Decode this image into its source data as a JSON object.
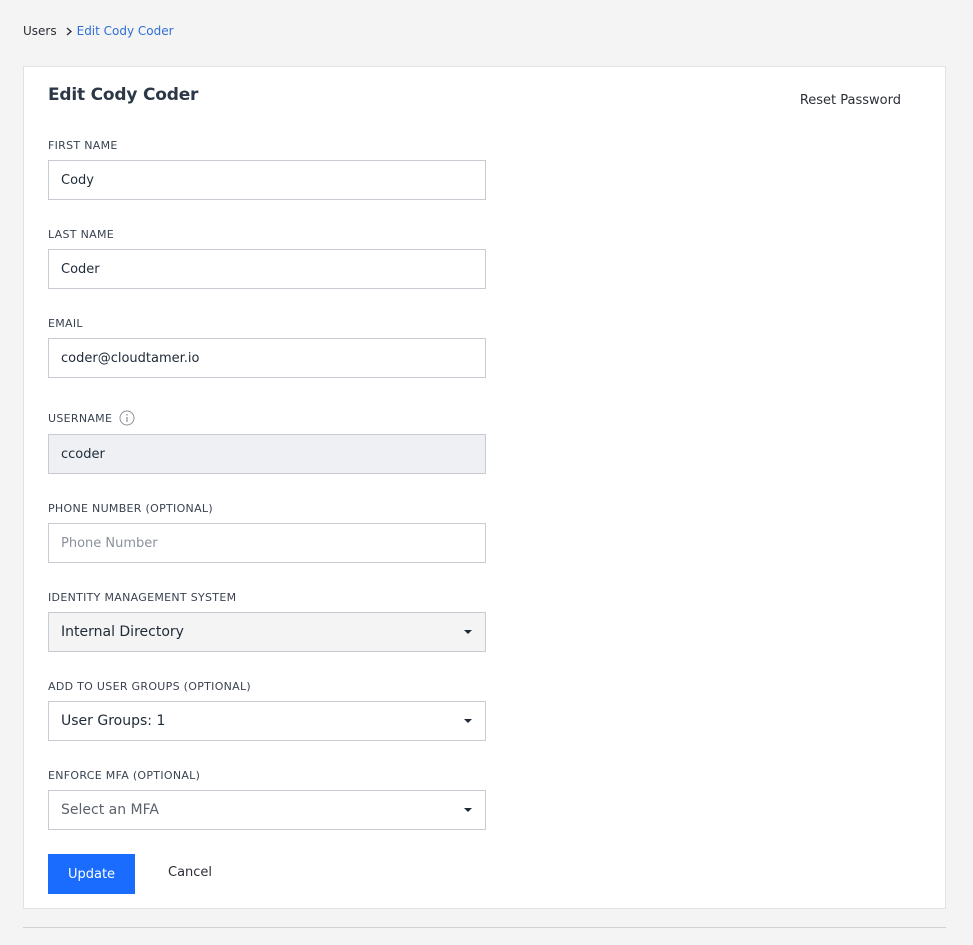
{
  "breadcrumb": {
    "root": "Users",
    "current": "Edit Cody Coder"
  },
  "page": {
    "title": "Edit Cody Coder",
    "reset_password": "Reset Password"
  },
  "fields": {
    "first_name": {
      "label": "FIRST NAME",
      "value": "Cody"
    },
    "last_name": {
      "label": "LAST NAME",
      "value": "Coder"
    },
    "email": {
      "label": "EMAIL",
      "value": "coder@cloudtamer.io"
    },
    "username": {
      "label": "USERNAME",
      "value": "ccoder",
      "icon": "info-icon"
    },
    "phone": {
      "label": "PHONE NUMBER (OPTIONAL)",
      "placeholder": "Phone Number"
    },
    "ims": {
      "label": "IDENTITY MANAGEMENT SYSTEM",
      "value": "Internal Directory"
    },
    "user_groups": {
      "label": "ADD TO USER GROUPS (OPTIONAL)",
      "value": "User Groups: 1"
    },
    "mfa": {
      "label": "ENFORCE MFA (OPTIONAL)",
      "placeholder": "Select an MFA"
    }
  },
  "actions": {
    "update": "Update",
    "cancel": "Cancel"
  },
  "colors": {
    "primary": "#1a6cff",
    "link": "#2f6fd6"
  }
}
